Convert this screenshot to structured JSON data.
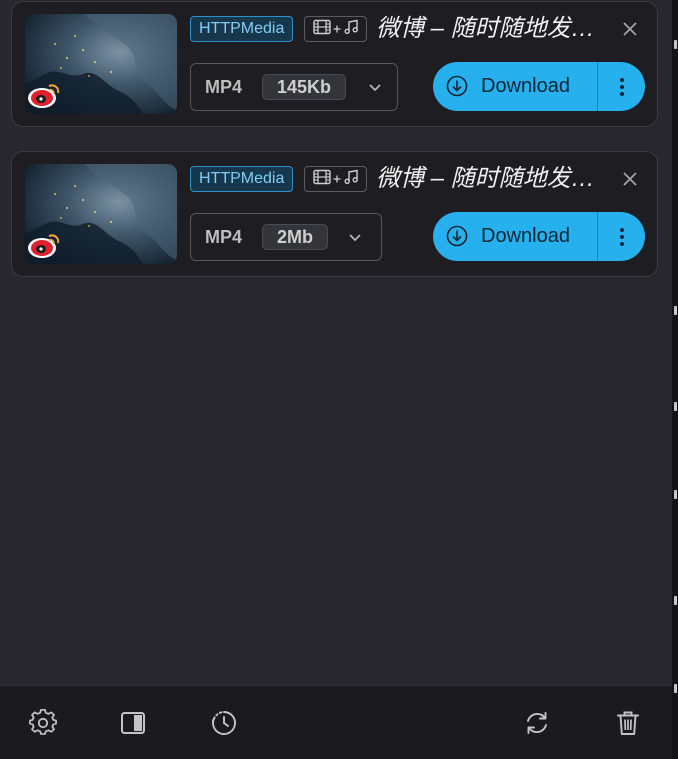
{
  "items": [
    {
      "source_badge": "HTTPMedia",
      "type_icons": [
        "film-icon",
        "plus",
        "music-note-icon"
      ],
      "title": "微博 – 随时随地发现新鲜事",
      "format": "MP4",
      "size": "145Kb",
      "download_label": "Download"
    },
    {
      "source_badge": "HTTPMedia",
      "type_icons": [
        "film-icon",
        "plus",
        "music-note-icon"
      ],
      "title": "微博 – 随时随地发现新鲜事",
      "format": "MP4",
      "size": "2Mb",
      "download_label": "Download"
    }
  ],
  "footer": {
    "buttons": [
      "gear-icon",
      "sidebar-toggle-icon",
      "history-clock-icon",
      "refresh-icon",
      "trash-icon"
    ]
  },
  "colors": {
    "accent": "#27b0ee",
    "badge_border": "#2f91c6",
    "badge_text": "#82cdf5",
    "panel_bg": "#27272d",
    "card_bg": "#1d1d22"
  }
}
